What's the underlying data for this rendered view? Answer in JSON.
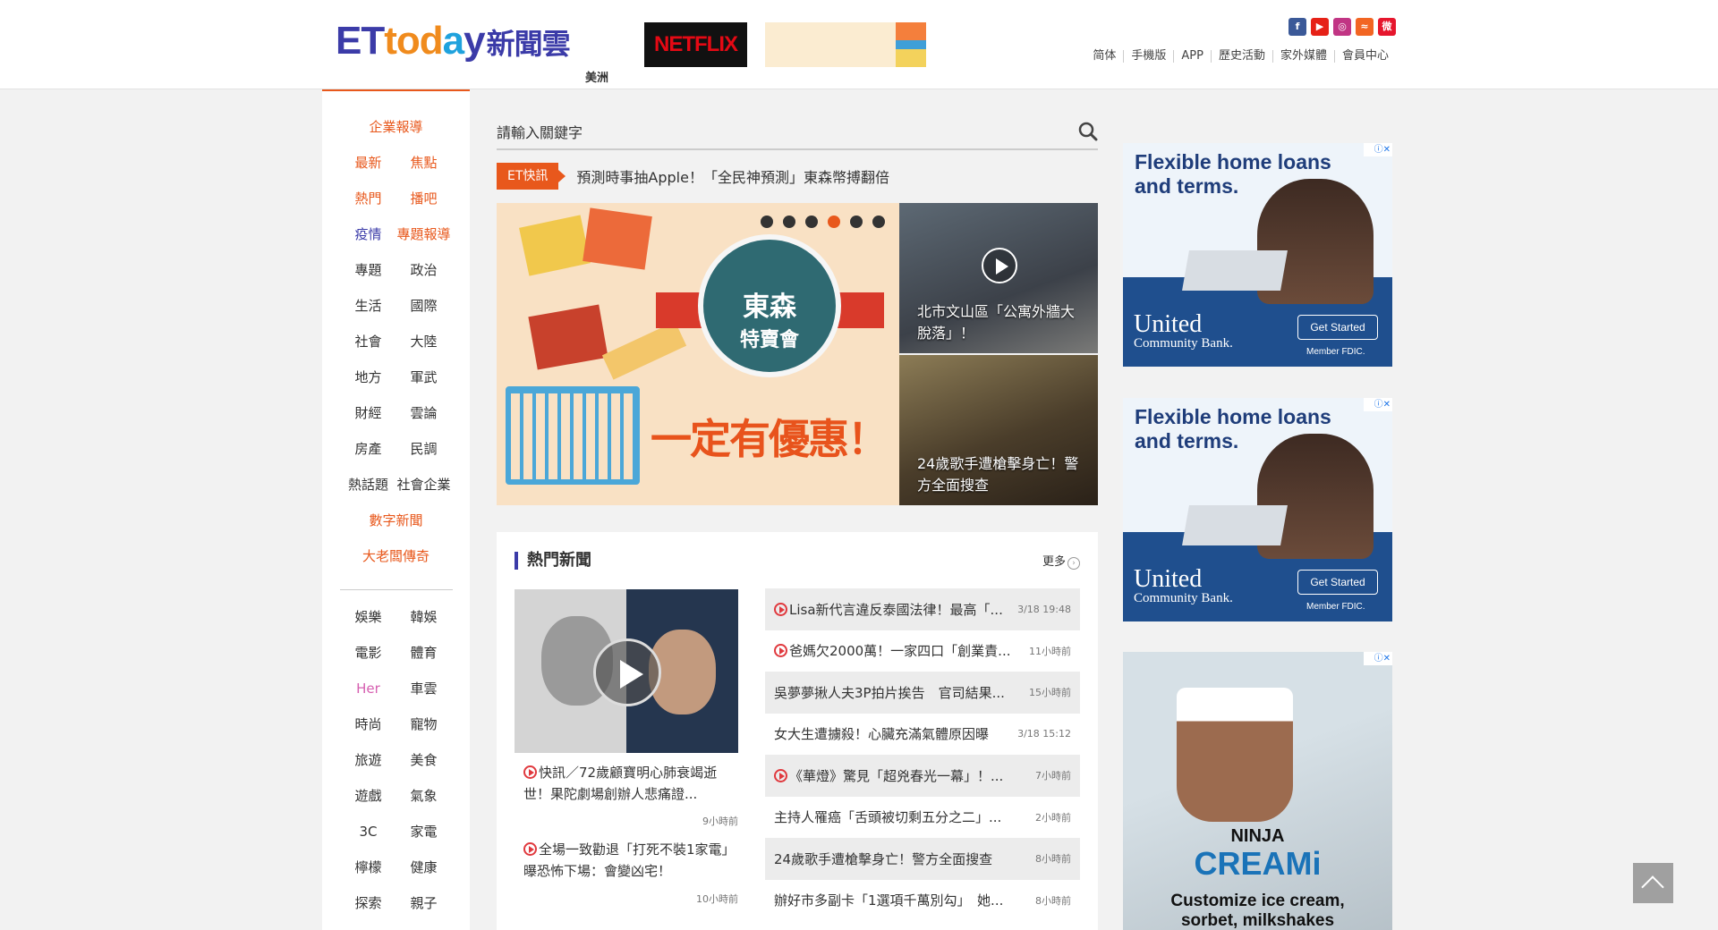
{
  "header": {
    "logo": {
      "e": "E",
      "t": "T",
      "to": "to",
      "d": "d",
      "a": "a",
      "y": "y",
      "cn": "新聞雲"
    },
    "region": "美洲",
    "netflix_ad": "NETFLIX",
    "toplinks": [
      "简体",
      "手機版",
      "APP",
      "歷史活動",
      "家外媒體",
      "會員中心"
    ],
    "social": [
      "f",
      "▶",
      "◎",
      "≈",
      "微"
    ]
  },
  "leftnav": {
    "top_single": "企業報導",
    "rows": [
      [
        "最新",
        "焦點"
      ],
      [
        "熱門",
        "播吧"
      ],
      [
        "疫情",
        "專題報導"
      ],
      [
        "專題",
        "政治"
      ],
      [
        "生活",
        "國際"
      ],
      [
        "社會",
        "大陸"
      ],
      [
        "地方",
        "軍武"
      ],
      [
        "財經",
        "雲論"
      ],
      [
        "房產",
        "民調"
      ],
      [
        "熱話題",
        "社會企業"
      ]
    ],
    "single2": "數字新聞",
    "single3": "大老闆傳奇",
    "rows2": [
      [
        "娛樂",
        "韓娛"
      ],
      [
        "電影",
        "體育"
      ],
      [
        "Her",
        "車雲"
      ],
      [
        "時尚",
        "寵物"
      ],
      [
        "旅遊",
        "美食"
      ],
      [
        "遊戲",
        "氣象"
      ],
      [
        "3C",
        "家電"
      ],
      [
        "檸檬",
        "健康"
      ],
      [
        "探索",
        "親子"
      ]
    ]
  },
  "search": {
    "placeholder": "請輸入關鍵字"
  },
  "flash": {
    "tag": "ET快訊",
    "text": "預測時事抽Apple！「全民神預測」東森幣搏翻倍"
  },
  "slider": {
    "badge_1": "東森",
    "badge_2": "特賣會",
    "slogan": "一定有優惠！",
    "active_dot": 4,
    "dot_count": 6
  },
  "thumbs": [
    {
      "caption": "北市文山區「公寓外牆大脫落」！"
    },
    {
      "caption": "24歲歌手遭槍擊身亡！警方全面搜查"
    }
  ],
  "hot": {
    "title": "熱門新聞",
    "more": "更多",
    "left_items": [
      {
        "text": "快訊／72歲顧寶明心肺衰竭逝世！果陀劇場創辦人悲痛證...",
        "time": "9小時前"
      },
      {
        "text": "全場一致勸退「打死不裝1家電」　曝恐怖下場：會變凶宅！",
        "time": "10小時前"
      }
    ],
    "list": [
      {
        "text": "Lisa新代言違反泰國法律！最高「...",
        "time": "3/18 19:48",
        "video": true
      },
      {
        "text": "爸媽欠2000萬！一家四口「創業責...",
        "time": "11小時前",
        "video": true
      },
      {
        "text": "吳夢夢揪人夫3P拍片挨告　官司結果...",
        "time": "15小時前",
        "video": false
      },
      {
        "text": "女大生遭擄殺！心臟充滿氣體原因曝",
        "time": "3/18 15:12",
        "video": false
      },
      {
        "text": "《華燈》驚見「超兇春光一幕」！...",
        "time": "7小時前",
        "video": true
      },
      {
        "text": "主持人罹癌「舌頭被切剩五分之二」...",
        "time": "2小時前",
        "video": false
      },
      {
        "text": "24歲歌手遭槍擊身亡！警方全面搜查",
        "time": "8小時前",
        "video": false
      },
      {
        "text": "辦好市多副卡「1選項千萬別勾」　她...",
        "time": "8小時前",
        "video": false
      }
    ]
  },
  "ads": {
    "bank": {
      "headline_1": "Flexible home loans",
      "headline_2": "and terms.",
      "brand": "United",
      "brand_sub": "Community Bank.",
      "cta": "Get Started",
      "fdic": "Member FDIC."
    },
    "ninja": {
      "n1": "NINJA",
      "n2": "CREAMi",
      "n3": "Customize ice cream,",
      "n4": "sorbet, milkshakes"
    },
    "ad_marker": "ⓘ✕"
  }
}
